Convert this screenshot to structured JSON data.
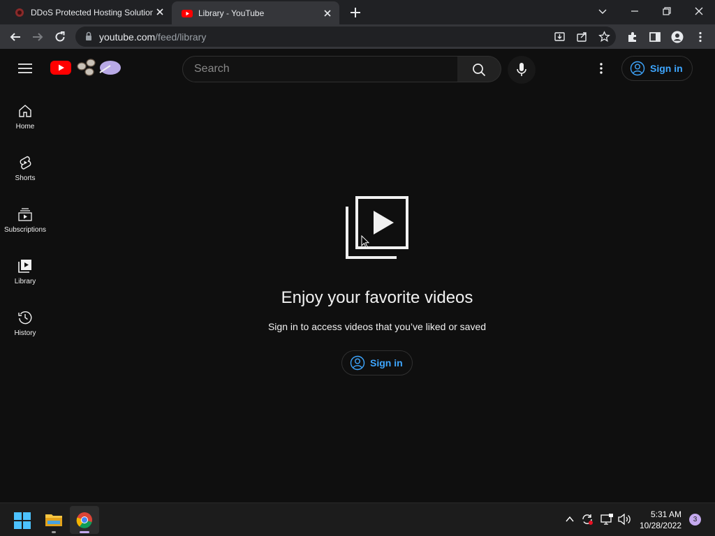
{
  "browser": {
    "tabs": [
      {
        "title": "DDoS Protected Hosting Solution"
      },
      {
        "title": "Library - YouTube"
      }
    ],
    "url_host": "youtube.com",
    "url_path": "/feed/library"
  },
  "header": {
    "search_placeholder": "Search",
    "signin_label": "Sign in"
  },
  "sidebar": {
    "items": [
      {
        "label": "Home",
        "icon": "home-icon"
      },
      {
        "label": "Shorts",
        "icon": "shorts-icon"
      },
      {
        "label": "Subscriptions",
        "icon": "subscriptions-icon"
      },
      {
        "label": "Library",
        "icon": "library-icon"
      },
      {
        "label": "History",
        "icon": "history-icon"
      }
    ]
  },
  "main": {
    "title": "Enjoy your favorite videos",
    "subtitle": "Sign in to access videos that you’ve liked or saved",
    "signin_label": "Sign in"
  },
  "taskbar": {
    "time": "5:31 AM",
    "date": "10/28/2022",
    "notification_count": "3"
  },
  "colors": {
    "background": "#0f0f0f",
    "accent_blue": "#3ea6ff",
    "youtube_red": "#ff0000"
  }
}
